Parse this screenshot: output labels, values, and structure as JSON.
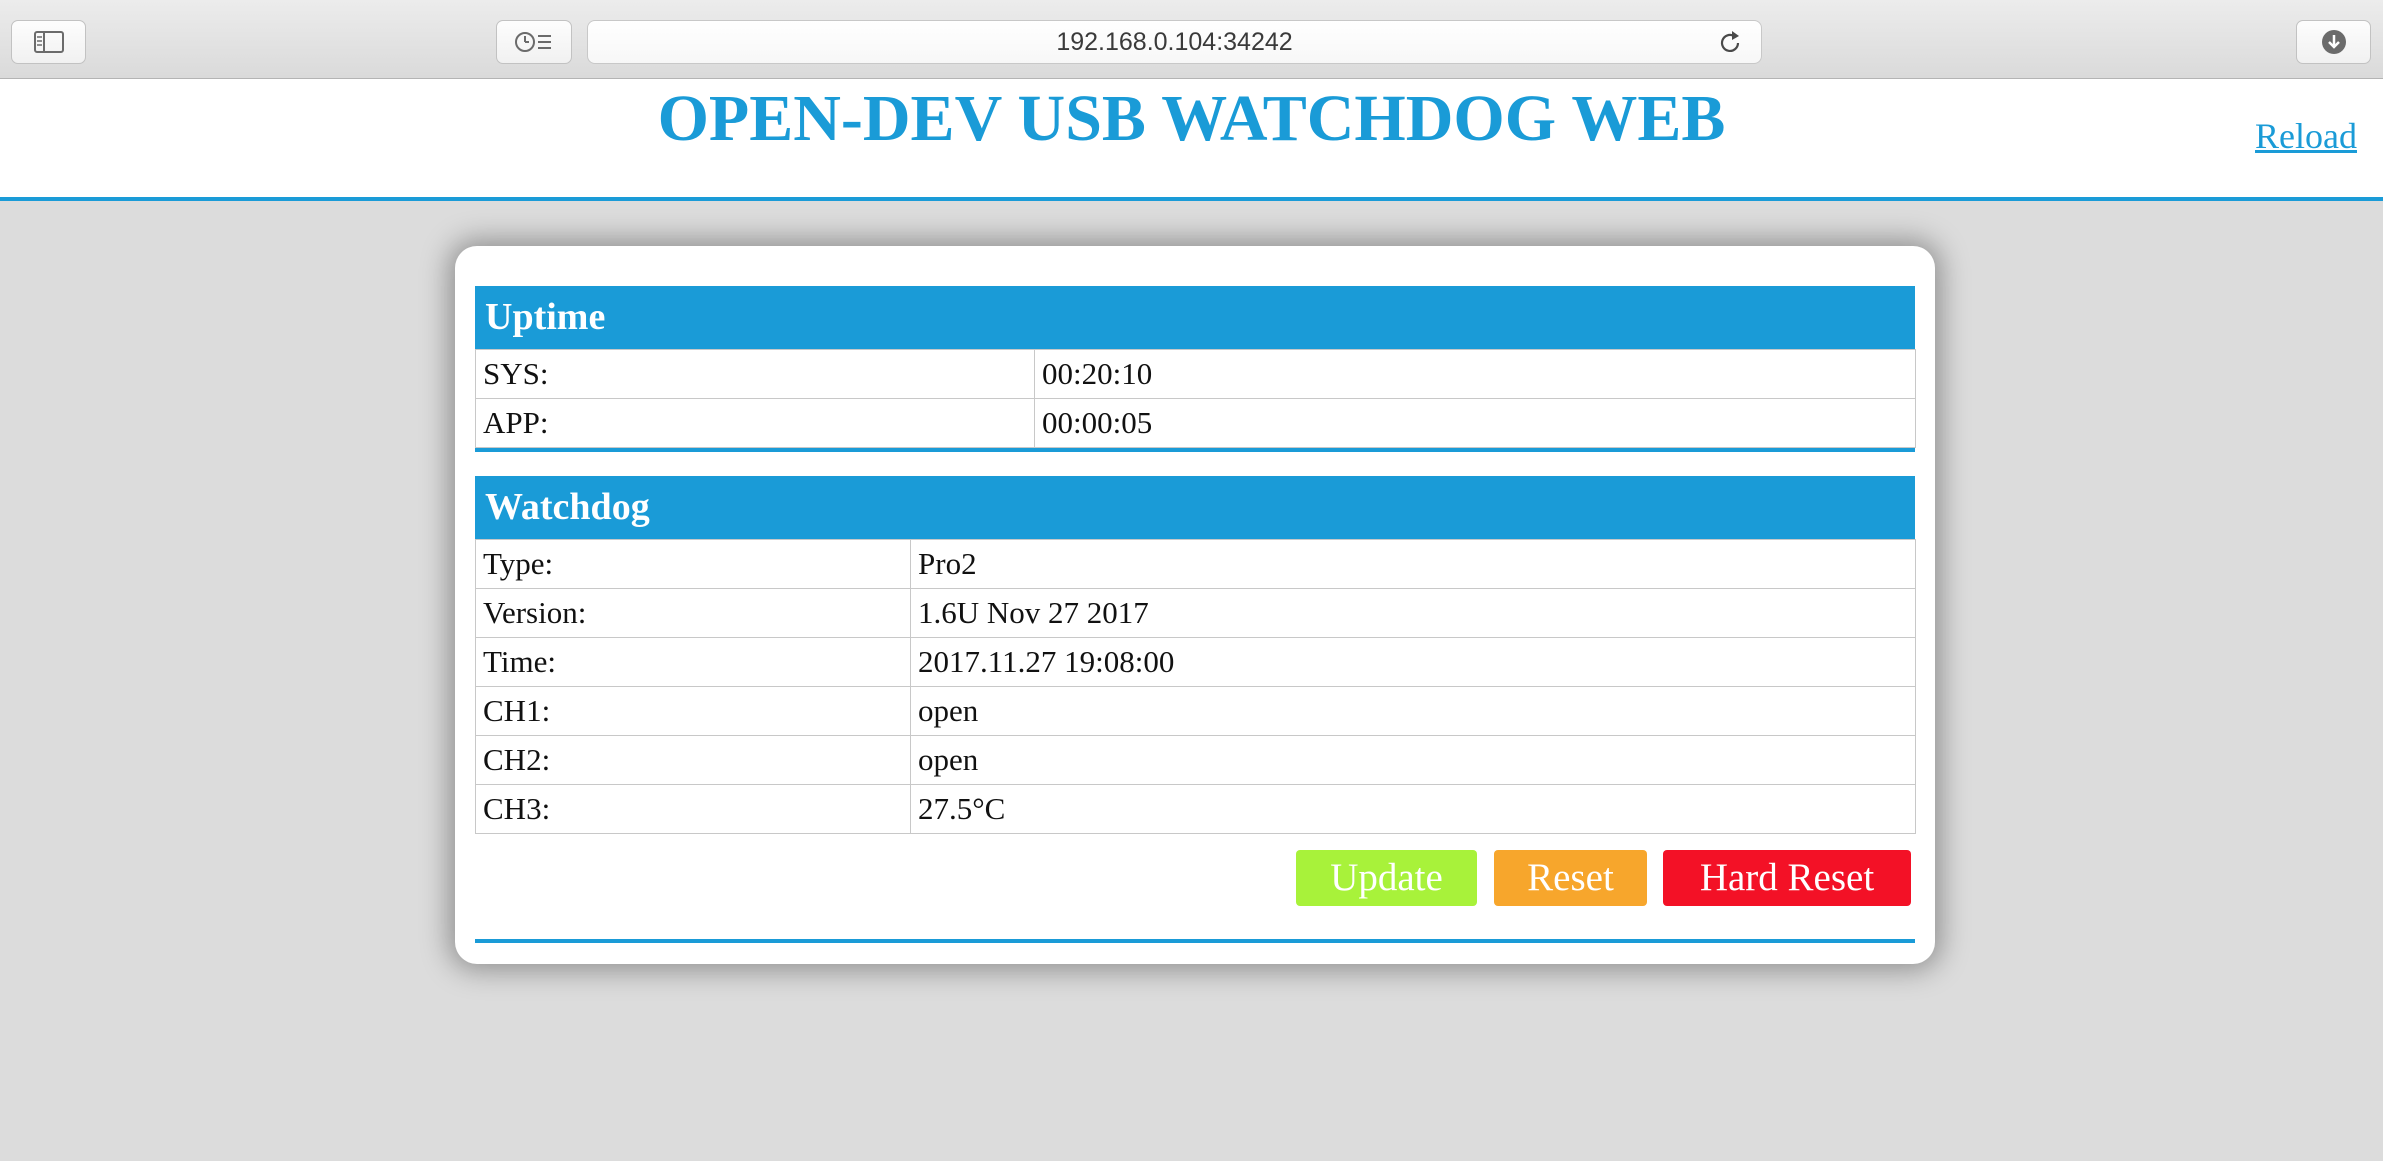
{
  "browser": {
    "address": "192.168.0.104:34242",
    "icons": {
      "sidebar": "sidebar-icon",
      "history": "history-icon",
      "reload": "reload-icon",
      "download": "download-icon"
    }
  },
  "header": {
    "title": "OPEN-DEV USB WATCHDOG WEB",
    "reload_label": "Reload"
  },
  "uptime": {
    "heading": "Uptime",
    "rows": [
      {
        "label": "SYS:",
        "value": "00:20:10"
      },
      {
        "label": "APP:",
        "value": "00:00:05"
      }
    ]
  },
  "watchdog": {
    "heading": "Watchdog",
    "rows": [
      {
        "label": "Type:",
        "value": "Pro2"
      },
      {
        "label": "Version:",
        "value": "1.6U Nov 27 2017"
      },
      {
        "label": "Time:",
        "value": "2017.11.27 19:08:00"
      },
      {
        "label": "CH1:",
        "value": "open"
      },
      {
        "label": "CH2:",
        "value": "open"
      },
      {
        "label": "CH3:",
        "value": "27.5°C"
      }
    ]
  },
  "actions": {
    "update_label": "Update",
    "reset_label": "Reset",
    "hard_reset_label": "Hard Reset"
  },
  "colors": {
    "accent": "#1a9bd7",
    "update": "#a8f23a",
    "reset": "#f7a62c",
    "hard_reset": "#f31126",
    "background": "#dcdcdc"
  }
}
